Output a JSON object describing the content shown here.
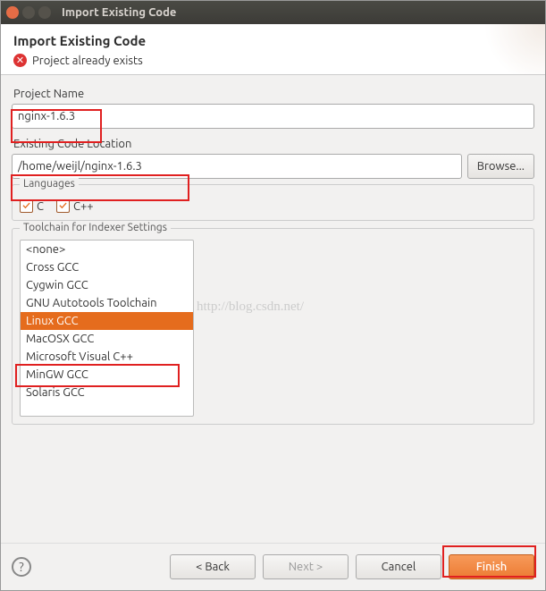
{
  "window": {
    "title": "Import Existing Code"
  },
  "header": {
    "title": "Import Existing Code",
    "error": "Project already exists"
  },
  "labels": {
    "project_name": "Project Name",
    "existing_location": "Existing Code Location",
    "browse": "Browse...",
    "languages_group": "Languages",
    "toolchain_group": "Toolchain for Indexer Settings"
  },
  "fields": {
    "project_name": "nginx-1.6.3",
    "existing_location": "/home/weijl/nginx-1.6.3"
  },
  "languages": {
    "c": "C",
    "cpp": "C++"
  },
  "toolchains": [
    "<none>",
    "Cross GCC",
    "Cygwin GCC",
    "GNU Autotools Toolchain",
    "Linux GCC",
    "MacOSX GCC",
    "Microsoft Visual C++",
    "MinGW GCC",
    "Solaris GCC"
  ],
  "toolchain_selected": "Linux GCC",
  "footer": {
    "back": "< Back",
    "next": "Next >",
    "cancel": "Cancel",
    "finish": "Finish"
  },
  "watermark": "http://blog.csdn.net/"
}
